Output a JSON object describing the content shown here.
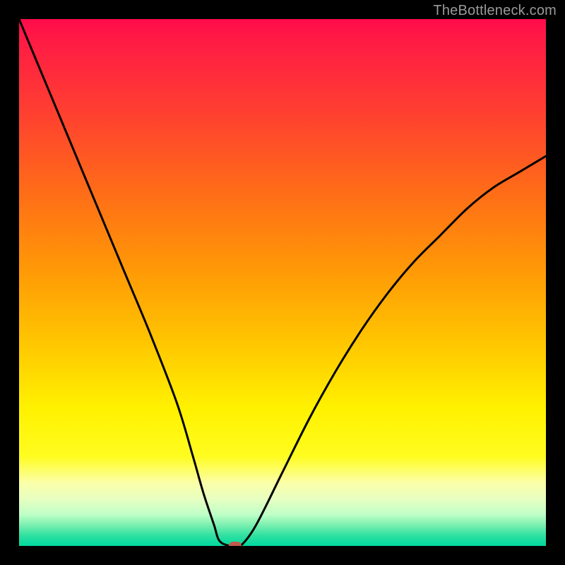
{
  "watermark": {
    "text": "TheBottleneck.com"
  },
  "chart_data": {
    "type": "line",
    "title": "",
    "xlabel": "",
    "ylabel": "",
    "xlim": [
      0,
      100
    ],
    "ylim": [
      0,
      100
    ],
    "gradient_stops": [
      {
        "pos": 0,
        "color": "#ff0a4a"
      },
      {
        "pos": 3,
        "color": "#ff1846"
      },
      {
        "pos": 18,
        "color": "#ff4030"
      },
      {
        "pos": 34,
        "color": "#ff7016"
      },
      {
        "pos": 48,
        "color": "#ff9a06"
      },
      {
        "pos": 62,
        "color": "#ffc800"
      },
      {
        "pos": 74,
        "color": "#fff200"
      },
      {
        "pos": 83,
        "color": "#fffc20"
      },
      {
        "pos": 88,
        "color": "#fbffa8"
      },
      {
        "pos": 91,
        "color": "#e8ffc0"
      },
      {
        "pos": 94,
        "color": "#c0ffc8"
      },
      {
        "pos": 96,
        "color": "#7cf0b0"
      },
      {
        "pos": 98,
        "color": "#30e0a0"
      },
      {
        "pos": 100,
        "color": "#00d8a0"
      }
    ],
    "series": [
      {
        "name": "bottleneck-curve",
        "x": [
          0,
          5,
          10,
          15,
          20,
          25,
          30,
          33,
          35,
          37,
          38,
          40,
          42,
          45,
          50,
          55,
          60,
          65,
          70,
          75,
          80,
          85,
          90,
          95,
          100
        ],
        "y": [
          100,
          88,
          76,
          64,
          52,
          40,
          27,
          17,
          10,
          4,
          1,
          0,
          0,
          4,
          14,
          24,
          33,
          41,
          48,
          54,
          59,
          64,
          68,
          71,
          74
        ]
      }
    ],
    "marker": {
      "x": 41,
      "y": 0,
      "color": "#c15a4a"
    }
  }
}
